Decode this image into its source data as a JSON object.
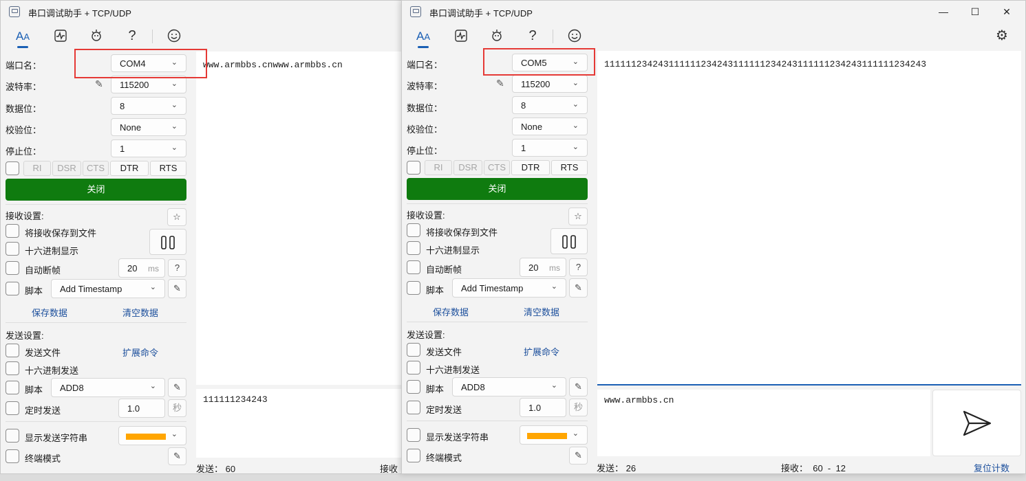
{
  "app_title": "串口调试助手 + TCP/UDP",
  "labels": {
    "port": "端口名：",
    "baud": "波特率：",
    "databits": "数据位：",
    "parity": "校验位：",
    "stopbits": "停止位：",
    "recv_settings": "接收设置:",
    "save_to_file": "将接收保存到文件",
    "hex_display": "十六进制显示",
    "auto_frame": "自动断帧",
    "script": "脚本",
    "save_data": "保存数据",
    "clear_data": "清空数据",
    "send_settings": "发送设置:",
    "send_file": "发送文件",
    "ext_cmd": "扩展命令",
    "hex_send": "十六进制发送",
    "timed_send": "定时发送",
    "show_send_str": "显示发送字符串",
    "terminal_mode": "终端模式",
    "ms": "ms",
    "sec": "秒",
    "question": "?"
  },
  "signals": [
    "RI",
    "DSR",
    "CTS",
    "DTR",
    "RTS"
  ],
  "left": {
    "port": "COM4",
    "baud": "115200",
    "databits": "8",
    "parity": "None",
    "stopbits": "1",
    "close_btn": "关闭",
    "frame_ms": "20",
    "recv_script": "Add Timestamp",
    "send_script": "ADD8",
    "timer": "1.0",
    "recv_text": "www.armbbs.cnwww.armbbs.cn",
    "send_text": "111111234243",
    "status_sent": "发送：  60",
    "status_recv": "接收"
  },
  "right": {
    "port": "COM5",
    "baud": "115200",
    "databits": "8",
    "parity": "None",
    "stopbits": "1",
    "close_btn": "关闭",
    "frame_ms": "20",
    "recv_script": "Add Timestamp",
    "send_script": "ADD8",
    "timer": "1.0",
    "recv_text": "111111234243111111234243111111234243111111234243111111234243",
    "send_text": "www.armbbs.cn",
    "status_sent": "发送：  26",
    "status_recv": "接收：  60  -  12",
    "reset_count": "复位计数"
  },
  "accent_color": "#1a5fb4",
  "open_button_color": "#0f7b0f",
  "highlight_color": "#e53935"
}
